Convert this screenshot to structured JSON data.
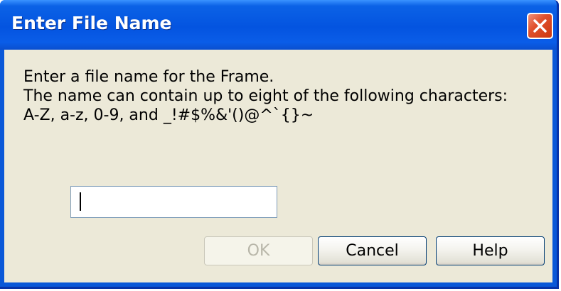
{
  "dialog": {
    "title": "Enter File Name",
    "close_icon": "close-icon",
    "message_lines": [
      "Enter a file name for the Frame.",
      "The name can contain up to eight of the following characters:",
      "A-Z, a-z, 0-9, and _!#$%&'()@^`{}~"
    ],
    "filename_input": {
      "value": ""
    },
    "buttons": {
      "ok": "OK",
      "cancel": "Cancel",
      "help": "Help"
    }
  },
  "colors": {
    "titlebar": "#0454e0",
    "client_bg": "#ece9d8",
    "close_button": "#e0502c"
  }
}
